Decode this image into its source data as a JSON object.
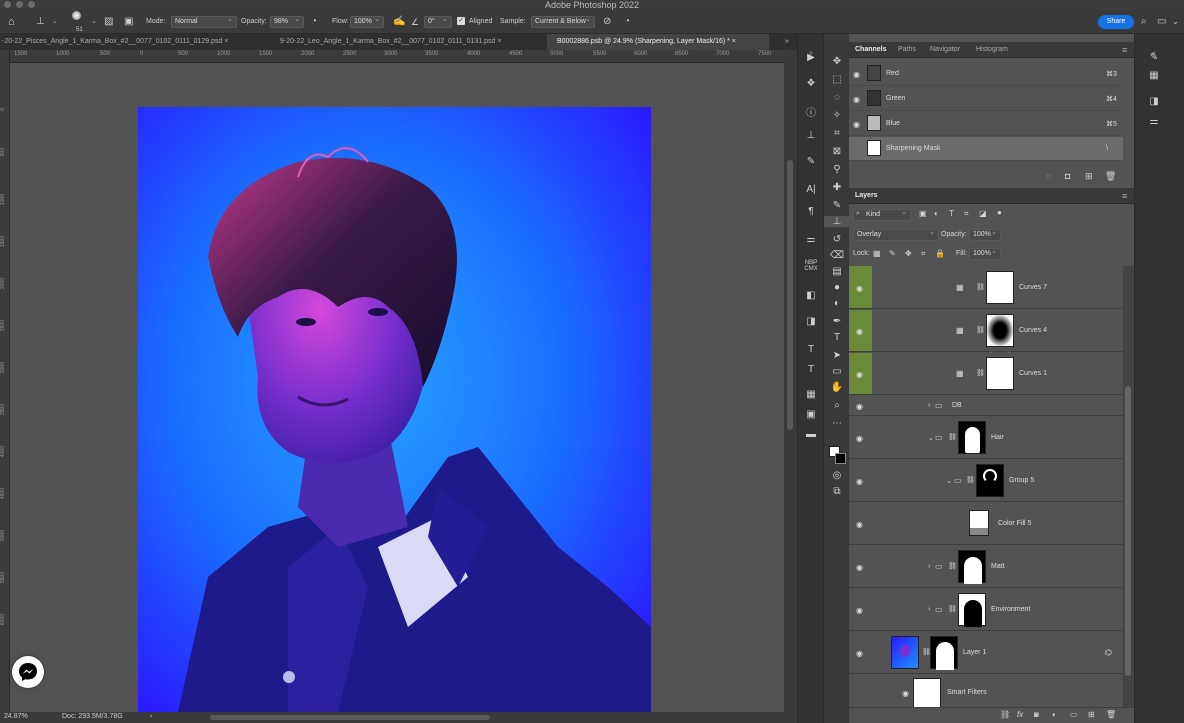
{
  "app_title": "Adobe Photoshop 2022",
  "options": {
    "brush_size": "51",
    "mode_label": "Mode:",
    "mode_value": "Normal",
    "opacity_label": "Opacity:",
    "opacity_value": "98%",
    "flow_label": "Flow:",
    "flow_value": "100%",
    "angle_value": "0°",
    "aligned_label": "Aligned",
    "sample_label": "Sample:",
    "sample_value": "Current & Below",
    "share_label": "Share"
  },
  "tabs": [
    {
      "label": "-20-22_Pisces_Angle_1_Karma_Box_#2__0077_0102_0111_0129.psd",
      "close": "×"
    },
    {
      "label": "9-20-22_Leo_Angle_1_Karma_Box_#2__0077_0102_0111_0131.psd",
      "close": "×"
    },
    {
      "label": "B0002886.psb @ 24.9% (Sharpening, Layer Mask/16) *",
      "close": "×"
    }
  ],
  "ruler_h": [
    "1500",
    "1000",
    "500",
    "0",
    "500",
    "1000",
    "1500",
    "2000",
    "2500",
    "3000",
    "3500",
    "4000",
    "4500",
    "5000",
    "5500",
    "6000",
    "6500",
    "7000",
    "7500"
  ],
  "ruler_v": [
    "0",
    "500",
    "1000",
    "1500",
    "2000",
    "2500",
    "3000",
    "3500",
    "4000",
    "4500",
    "5000",
    "5500",
    "6000"
  ],
  "status": {
    "zoom": "24.87%",
    "doc": "Doc: 293.5M/3.78G",
    "arrow": "›"
  },
  "channels_panel": {
    "tabs": [
      "Channels",
      "Paths",
      "Navigator",
      "Histogram"
    ],
    "rows": [
      {
        "name": "Red",
        "shortcut": "⌘3"
      },
      {
        "name": "Green",
        "shortcut": "⌘4"
      },
      {
        "name": "Blue",
        "shortcut": "⌘5"
      },
      {
        "name": "Sharpening Mask",
        "shortcut": "\\"
      }
    ]
  },
  "layers_panel": {
    "title": "Layers",
    "kind_label": "Kind",
    "blend_mode": "Overlay",
    "opacity_label": "Opacity:",
    "opacity_value": "100%",
    "lock_label": "Lock:",
    "fill_label": "Fill:",
    "fill_value": "100%",
    "layers": [
      {
        "name": "Curves 7"
      },
      {
        "name": "Curves 4"
      },
      {
        "name": "Curves 1"
      },
      {
        "name": "DB"
      },
      {
        "name": "Hair"
      },
      {
        "name": "Group 5"
      },
      {
        "name": "Color Fill 5"
      },
      {
        "name": "Matt"
      },
      {
        "name": "Environment"
      },
      {
        "name": "Layer 1"
      },
      {
        "name": "Smart Filters"
      }
    ]
  },
  "colors": {
    "accent": "#1473e6",
    "group_highlight": "#6a8a3a",
    "photo_bg_top": "#2a1bff",
    "photo_bg_center": "#1e90ff"
  }
}
